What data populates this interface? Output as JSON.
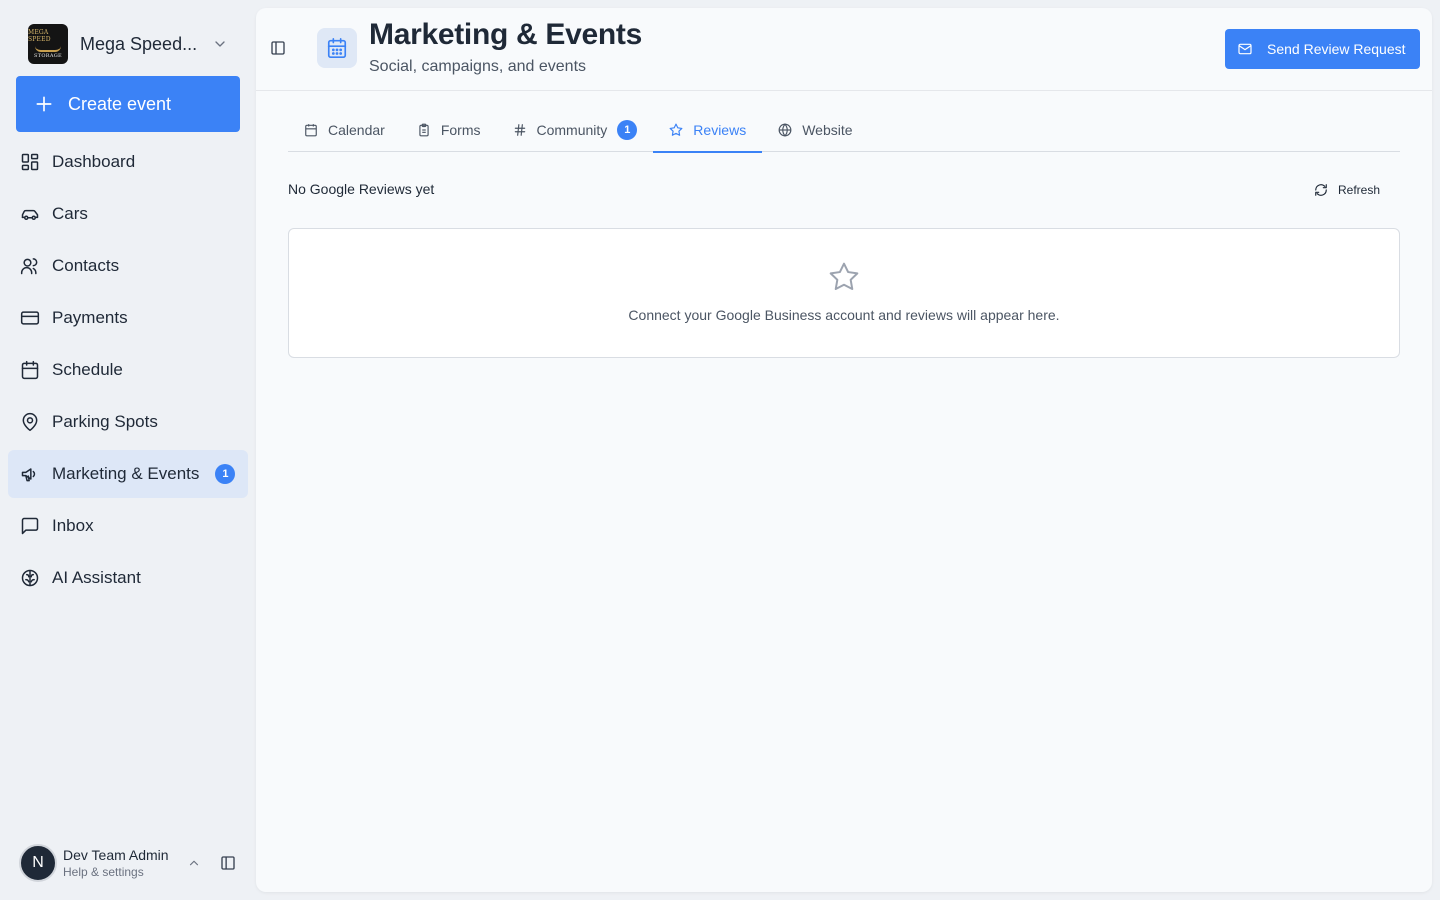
{
  "brand": {
    "name": "Mega Speed...",
    "logo_line1": "MEGA SPEED",
    "logo_line2": "STORAGE"
  },
  "sidebar": {
    "create_label": "Create event",
    "items": [
      {
        "label": "Dashboard",
        "icon": "dashboard-grid-icon"
      },
      {
        "label": "Cars",
        "icon": "car-icon"
      },
      {
        "label": "Contacts",
        "icon": "users-icon"
      },
      {
        "label": "Payments",
        "icon": "credit-card-icon"
      },
      {
        "label": "Schedule",
        "icon": "calendar-icon"
      },
      {
        "label": "Parking Spots",
        "icon": "map-pin-icon"
      },
      {
        "label": "Marketing & Events",
        "icon": "megaphone-icon",
        "active": true,
        "badge": "1"
      },
      {
        "label": "Inbox",
        "icon": "message-square-icon"
      },
      {
        "label": "AI Assistant",
        "icon": "brain-icon"
      }
    ]
  },
  "user": {
    "initial": "N",
    "name": "Dev Team Admin",
    "subtitle": "Help & settings"
  },
  "header": {
    "title": "Marketing & Events",
    "subtitle": "Social, campaigns, and events",
    "send_button": "Send Review Request"
  },
  "tabs": [
    {
      "label": "Calendar",
      "icon": "calendar-icon"
    },
    {
      "label": "Forms",
      "icon": "clipboard-icon"
    },
    {
      "label": "Community",
      "icon": "hash-icon",
      "badge": "1"
    },
    {
      "label": "Reviews",
      "icon": "star-icon",
      "active": true
    },
    {
      "label": "Website",
      "icon": "globe-icon"
    }
  ],
  "reviews": {
    "title": "No Google Reviews yet",
    "refresh_label": "Refresh",
    "empty_message": "Connect your Google Business account and reviews will appear here."
  },
  "colors": {
    "accent": "#3b82f6",
    "active_nav_bg": "#dde7f7",
    "sidebar_bg": "#eef1f5",
    "panel_bg": "#f8fafc"
  }
}
